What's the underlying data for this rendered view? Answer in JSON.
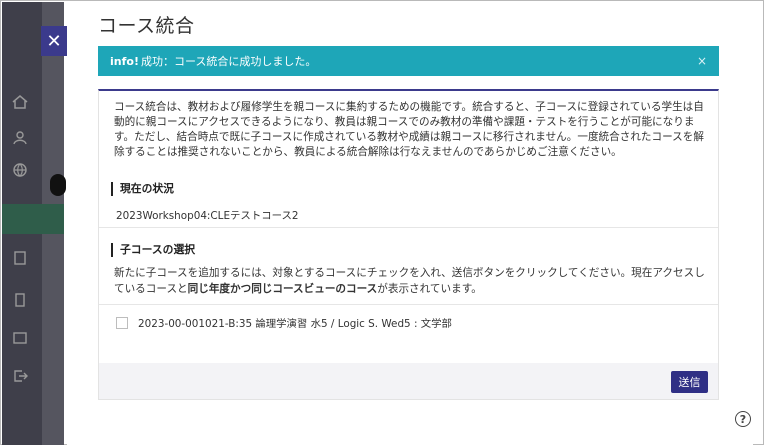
{
  "modal": {
    "title": "コース統合",
    "alert": {
      "strong": "info!",
      "text": "成功：コース統合に成功しました。",
      "close": "×"
    },
    "description": "コース統合は、教材および履修学生を親コースに集約するための機能です。統合すると、子コースに登録されている学生は自動的に親コースにアクセスできるようになり、教員は親コースでのみ教材の準備や課題・テストを行うことが可能になります。ただし、結合時点で既に子コースに作成されている教材や成績は親コースに移行されません。一度統合されたコースを解除することは推奨されないことから、教員による統合解除は行なえませんのであらかじめご注意ください。",
    "current_heading": "現在の状況",
    "current_course": "2023Workshop04:CLEテストコース2",
    "child_heading": "子コースの選択",
    "child_desc_1": "新たに子コースを追加するには、対象とするコースにチェックを入れ、送信ボタンをクリックしてください。現在アクセスしているコースと",
    "child_desc_bold": "同じ年度かつ同じコースビューのコース",
    "child_desc_2": "が表示されています。",
    "courses": [
      {
        "label": "2023-00-001021-B:35 論理学演習 水5 / Logic S. Wed5 : 文学部",
        "checked": false
      }
    ],
    "submit_label": "送信"
  },
  "close_button": "✕",
  "help_icon": "?",
  "colors": {
    "accent": "#3b3a8c",
    "alert": "#1ea6b8",
    "submit": "#2f2f85"
  }
}
